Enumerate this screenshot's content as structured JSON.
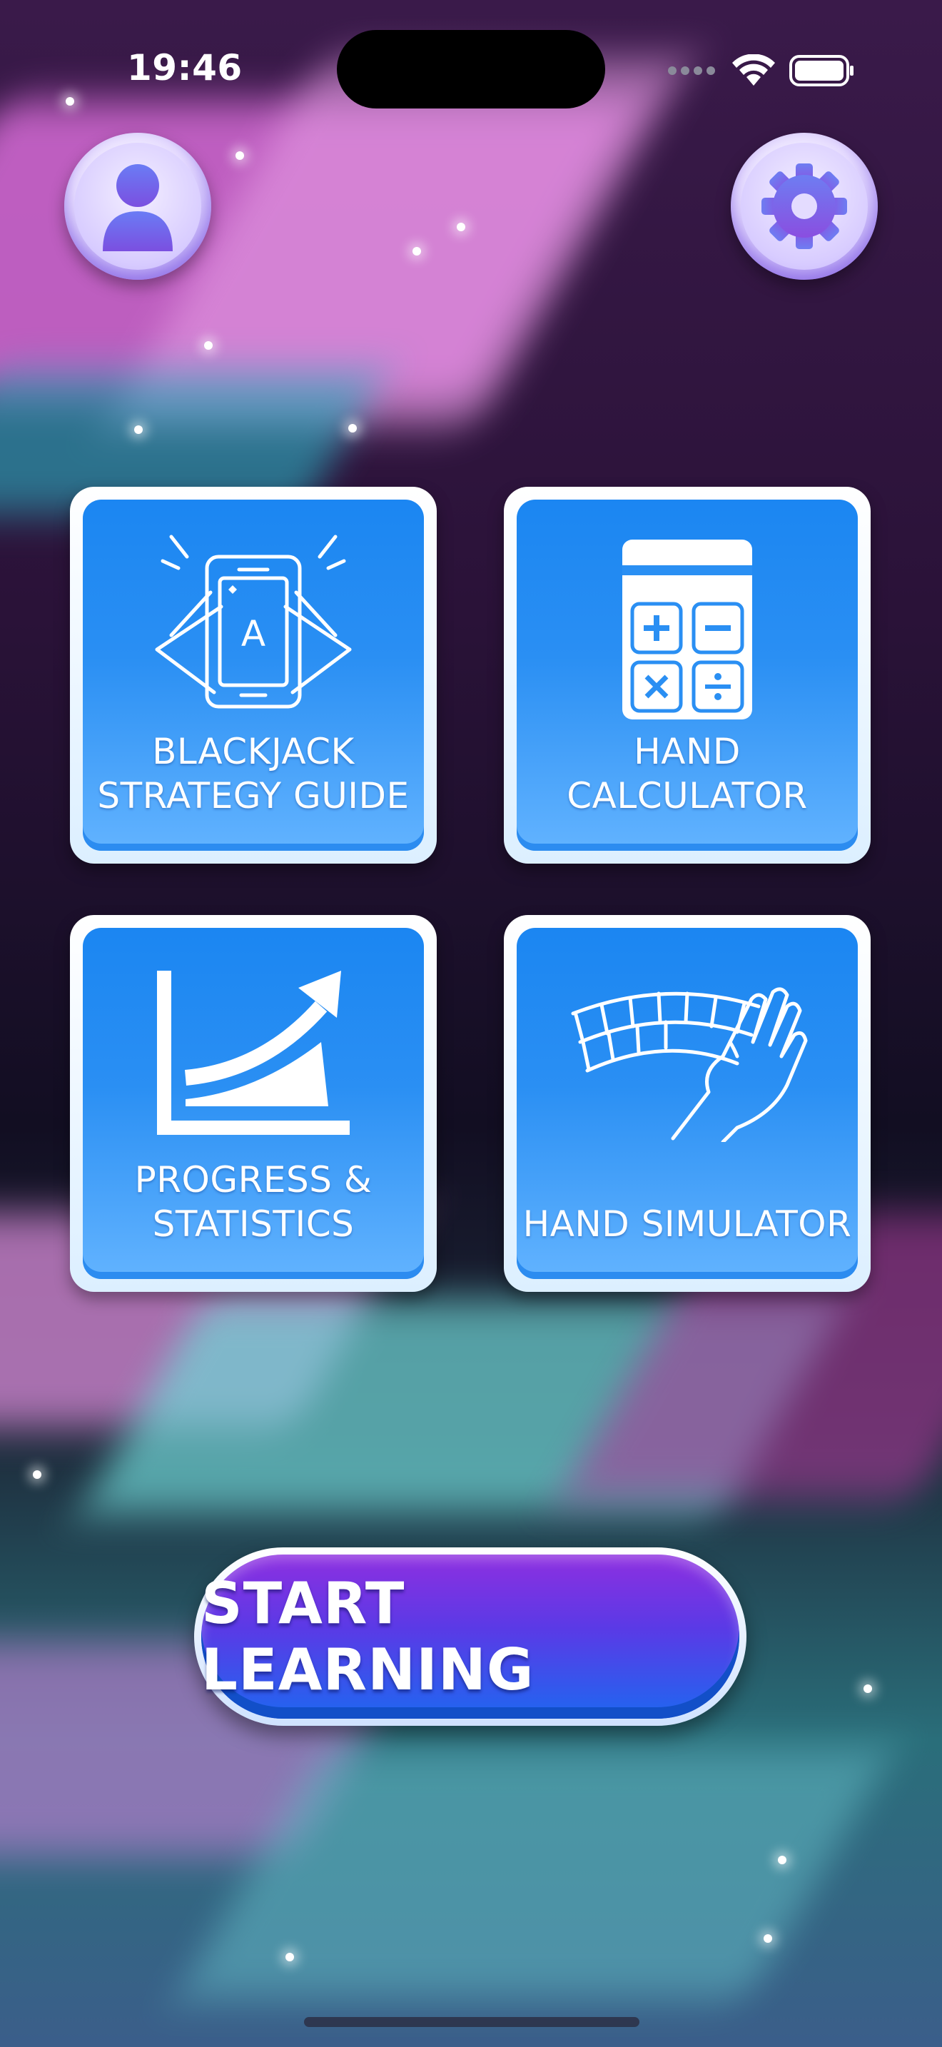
{
  "status_bar": {
    "time": "19:46"
  },
  "header": {
    "profile_icon": "user-icon",
    "settings_icon": "gear-icon"
  },
  "menu": {
    "tiles": [
      {
        "label": "BLACKJACK\nSTRATEGY GUIDE",
        "icon": "phone-cards-icon"
      },
      {
        "label": "HAND CALCULATOR",
        "icon": "calculator-icon"
      },
      {
        "label": "PROGRESS &\nSTATISTICS",
        "icon": "growth-chart-icon"
      },
      {
        "label": "HAND SIMULATOR",
        "icon": "hand-cards-icon"
      }
    ]
  },
  "start_button": {
    "label": "START LEARNING"
  },
  "colors": {
    "tile_blue": "#1b86f2",
    "start_purple": "#8e2fe0",
    "start_blue": "#1f67f0"
  }
}
